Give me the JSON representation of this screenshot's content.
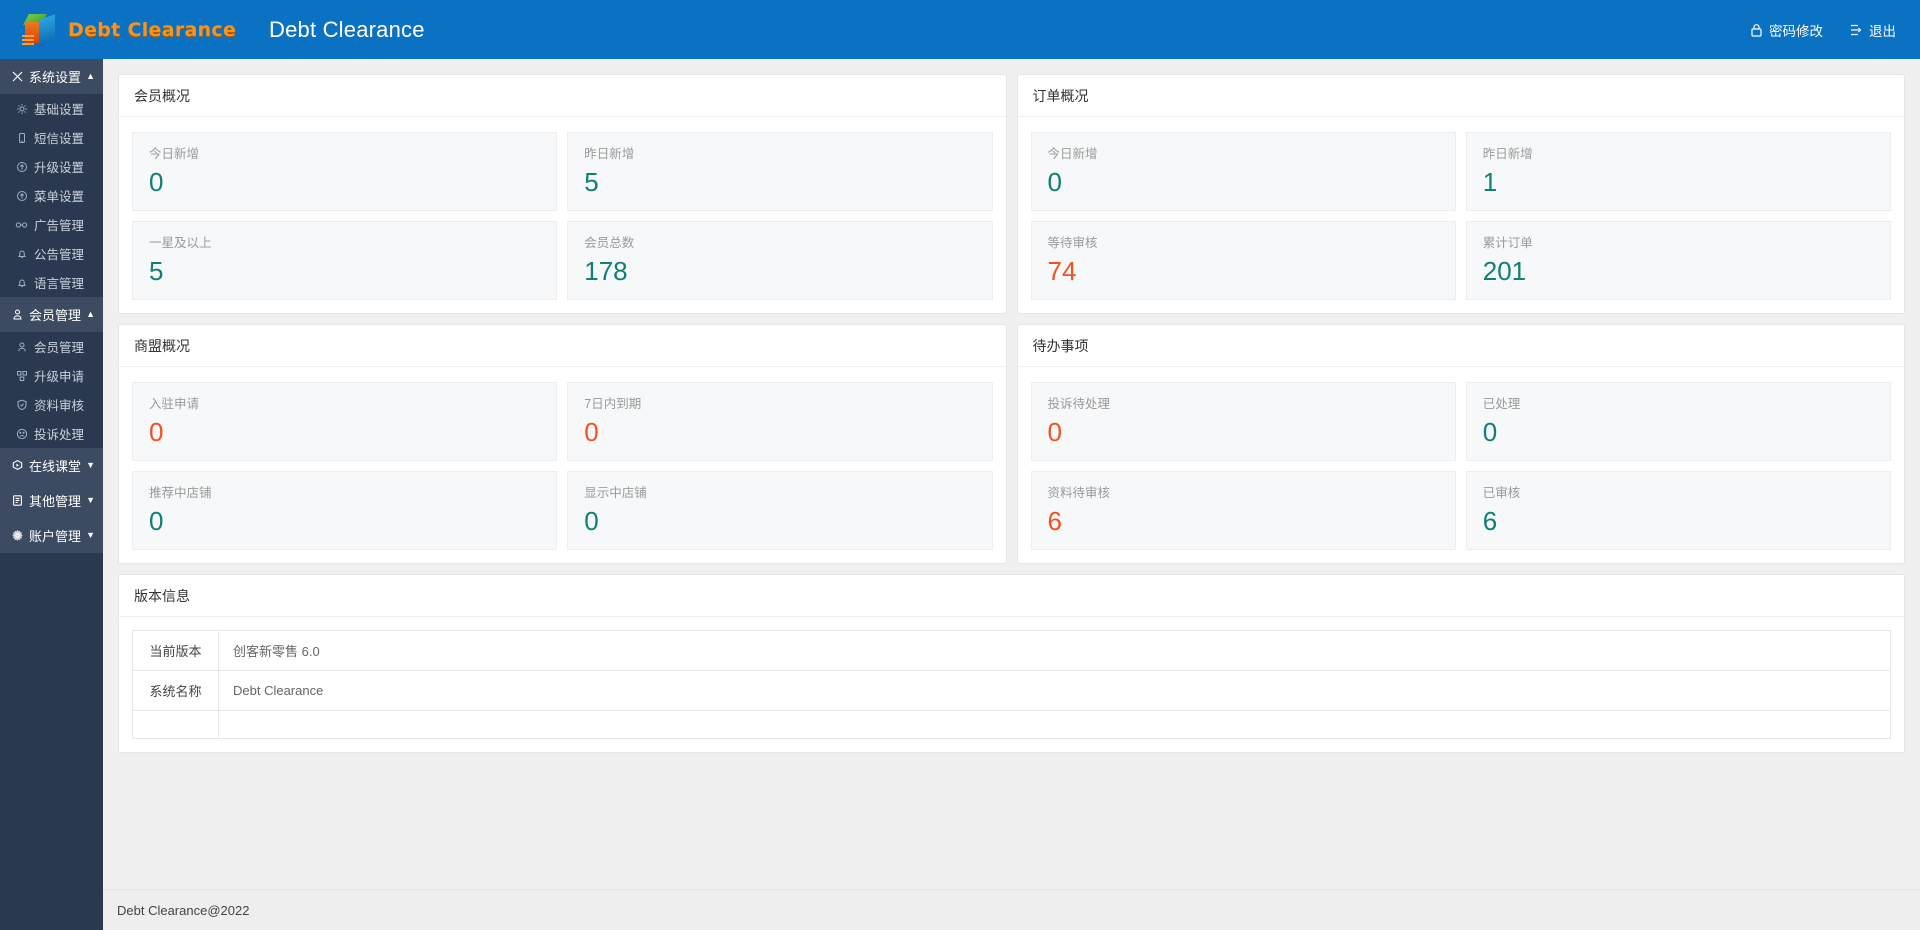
{
  "header": {
    "brand_text": "Debt Clearance",
    "app_title": "Debt Clearance",
    "logo_icon": "cube-logo-icon",
    "links": [
      {
        "label": "密码修改",
        "icon": "lock-icon"
      },
      {
        "label": "退出",
        "icon": "logout-icon"
      }
    ]
  },
  "sidebar": {
    "groups": [
      {
        "label": "系统设置",
        "icon": "tools-icon",
        "caret": "▲",
        "expanded": true,
        "items": [
          {
            "label": "基础设置",
            "icon": "gear-icon"
          },
          {
            "label": "短信设置",
            "icon": "mobile-icon"
          },
          {
            "label": "升级设置",
            "icon": "upgrade-icon"
          },
          {
            "label": "菜单设置",
            "icon": "menu-circle-icon"
          },
          {
            "label": "广告管理",
            "icon": "glasses-icon"
          },
          {
            "label": "公告管理",
            "icon": "bell-icon"
          },
          {
            "label": "语言管理",
            "icon": "bell-icon"
          }
        ]
      },
      {
        "label": "会员管理",
        "icon": "member-icon",
        "caret": "▲",
        "expanded": true,
        "items": [
          {
            "label": "会员管理",
            "icon": "user-icon"
          },
          {
            "label": "升级申请",
            "icon": "upgrade-apply-icon"
          },
          {
            "label": "资料审核",
            "icon": "shield-check-icon"
          },
          {
            "label": "投诉处理",
            "icon": "sad-face-icon"
          }
        ]
      },
      {
        "label": "在线课堂",
        "icon": "classroom-icon",
        "caret": "▼",
        "expanded": false,
        "items": []
      },
      {
        "label": "其他管理",
        "icon": "document-icon",
        "caret": "▼",
        "expanded": false,
        "items": []
      },
      {
        "label": "账户管理",
        "icon": "gear-solid-icon",
        "caret": "▼",
        "expanded": false,
        "items": []
      }
    ]
  },
  "panels": [
    {
      "id": "member-overview",
      "title": "会员概况",
      "stats": [
        {
          "label": "今日新增",
          "value": "0",
          "color": "green"
        },
        {
          "label": "昨日新增",
          "value": "5",
          "color": "green"
        },
        {
          "label": "一星及以上",
          "value": "5",
          "color": "green"
        },
        {
          "label": "会员总数",
          "value": "178",
          "color": "green"
        }
      ]
    },
    {
      "id": "order-overview",
      "title": "订单概况",
      "stats": [
        {
          "label": "今日新增",
          "value": "0",
          "color": "green"
        },
        {
          "label": "昨日新增",
          "value": "1",
          "color": "green"
        },
        {
          "label": "等待审核",
          "value": "74",
          "color": "red"
        },
        {
          "label": "累计订单",
          "value": "201",
          "color": "green"
        }
      ]
    },
    {
      "id": "alliance-overview",
      "title": "商盟概况",
      "stats": [
        {
          "label": "入驻申请",
          "value": "0",
          "color": "red"
        },
        {
          "label": "7日内到期",
          "value": "0",
          "color": "red"
        },
        {
          "label": "推荐中店铺",
          "value": "0",
          "color": "green"
        },
        {
          "label": "显示中店铺",
          "value": "0",
          "color": "green"
        }
      ]
    },
    {
      "id": "todo-items",
      "title": "待办事项",
      "stats": [
        {
          "label": "投诉待处理",
          "value": "0",
          "color": "red"
        },
        {
          "label": "已处理",
          "value": "0",
          "color": "green"
        },
        {
          "label": "资料待审核",
          "value": "6",
          "color": "red"
        },
        {
          "label": "已审核",
          "value": "6",
          "color": "green"
        }
      ]
    }
  ],
  "version_panel": {
    "title": "版本信息",
    "rows": [
      {
        "key": "当前版本",
        "value": "创客新零售 6.0"
      },
      {
        "key": "系统名称",
        "value": "Debt Clearance"
      },
      {
        "key": "",
        "value": ""
      }
    ]
  },
  "footer": {
    "text": "Debt Clearance@2022"
  },
  "colors": {
    "header_blue": "#0b71c3",
    "sidebar_bg": "#2b3950",
    "sidebar_group_bg": "#3c4b62",
    "brand_orange": "#f7941e",
    "stat_green": "#0e8074",
    "stat_red": "#f4511e"
  }
}
